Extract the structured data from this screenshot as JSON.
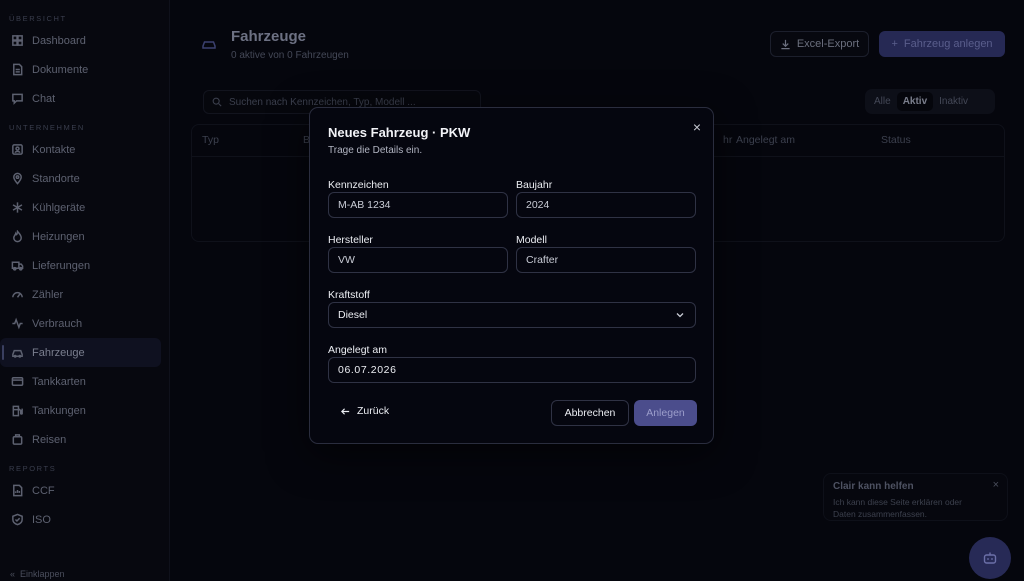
{
  "sidebar": {
    "sections": [
      {
        "label": "ÜBERSICHT",
        "items": [
          {
            "label": "Dashboard",
            "icon": "dashboard-icon"
          },
          {
            "label": "Dokumente",
            "icon": "document-icon"
          },
          {
            "label": "Chat",
            "icon": "chat-icon"
          }
        ]
      },
      {
        "label": "UNTERNEHMEN",
        "items": [
          {
            "label": "Kontakte",
            "icon": "contacts-icon"
          },
          {
            "label": "Standorte",
            "icon": "location-icon"
          },
          {
            "label": "Kühlgeräte",
            "icon": "snowflake-icon"
          },
          {
            "label": "Heizungen",
            "icon": "flame-icon"
          },
          {
            "label": "Lieferungen",
            "icon": "truck-icon"
          },
          {
            "label": "Zähler",
            "icon": "gauge-icon"
          },
          {
            "label": "Verbrauch",
            "icon": "activity-icon"
          },
          {
            "label": "Fahrzeuge",
            "icon": "car-icon",
            "active": true
          },
          {
            "label": "Tankkarten",
            "icon": "card-icon"
          },
          {
            "label": "Tankungen",
            "icon": "fuel-icon"
          },
          {
            "label": "Reisen",
            "icon": "luggage-icon"
          }
        ]
      },
      {
        "label": "REPORTS",
        "items": [
          {
            "label": "CCF",
            "icon": "report-icon"
          },
          {
            "label": "ISO",
            "icon": "shield-check-icon"
          }
        ]
      }
    ],
    "collapse_label": "Einklappen"
  },
  "page": {
    "title": "Fahrzeuge",
    "subtitle": "0 aktive von 0 Fahrzeugen",
    "export_label": "Excel-Export",
    "new_label": "Fahrzeug anlegen",
    "search_placeholder": "Suchen nach Kennzeichen, Typ, Modell ...",
    "filters": [
      "Alle",
      "Aktiv",
      "Inaktiv"
    ],
    "active_filter": "Aktiv",
    "columns": [
      "Typ",
      "B",
      "hr",
      "Angelegt am",
      "Status"
    ]
  },
  "modal": {
    "title": "Neues Fahrzeug · PKW",
    "subtitle": "Trage die Details ein.",
    "fields": {
      "kennzeichen": {
        "label": "Kennzeichen",
        "value": "M-AB 1234"
      },
      "baujahr": {
        "label": "Baujahr",
        "value": "2024"
      },
      "hersteller": {
        "label": "Hersteller",
        "value": "VW"
      },
      "modell": {
        "label": "Modell",
        "value": "Crafter"
      },
      "kraftstoff": {
        "label": "Kraftstoff",
        "value": "Diesel"
      },
      "angelegt": {
        "label": "Angelegt am",
        "value": "06.07.2026"
      }
    },
    "back_label": "Zurück",
    "cancel_label": "Abbrechen",
    "create_label": "Anlegen",
    "close_glyph": "×"
  },
  "toast": {
    "title": "Clair kann helfen",
    "text": "Ich kann diese Seite erklären oder Daten zusammenfassen.",
    "close_glyph": "×"
  },
  "colors": {
    "accent": "#4b4d8c",
    "background": "#05060d",
    "modal_border": "#2a2d3e"
  }
}
